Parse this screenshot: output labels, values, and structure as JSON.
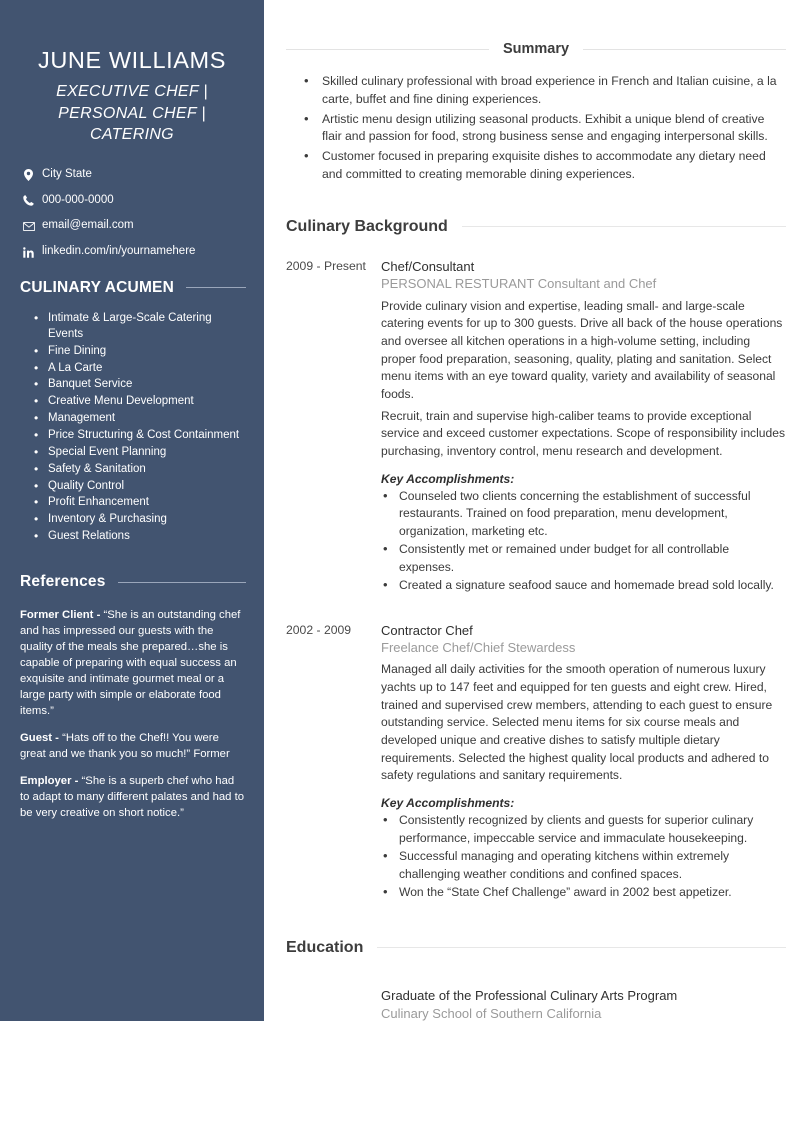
{
  "theme": {
    "sidebar_bg": "#425470",
    "page_bg": "#ffffff",
    "heading_color": "#3d3d3d",
    "muted_color": "#9a9a9a",
    "rule_color": "#e3e3e3"
  },
  "sidebar": {
    "name": "JUNE WILLIAMS",
    "headline": "EXECUTIVE CHEF | PERSONAL CHEF | CATERING",
    "contact": [
      {
        "icon": "location-pin-icon",
        "text": "City State"
      },
      {
        "icon": "phone-icon",
        "text": "000-000-0000"
      },
      {
        "icon": "envelope-icon",
        "text": "email@email.com"
      },
      {
        "icon": "linkedin-icon",
        "text": "linkedin.com/in/yournamehere"
      }
    ],
    "skills_heading": "CULINARY ACUMEN",
    "skills": [
      "Intimate & Large-Scale Catering Events",
      "Fine Dining",
      "A La Carte",
      "Banquet Service",
      "Creative Menu Development",
      "Management",
      "Price Structuring & Cost Containment",
      "Special Event Planning",
      "Safety & Sanitation",
      "Quality Control",
      "Profit Enhancement",
      "Inventory & Purchasing",
      "Guest Relations"
    ],
    "references_heading": "References",
    "references": [
      {
        "who": "Former Client - ",
        "quote": "“She is an outstanding chef and has impressed our guests with the quality of the meals she prepared…she is capable of preparing with equal success an exquisite and intimate gourmet meal or a large party with simple or elaborate food items.”"
      },
      {
        "who": "Guest - ",
        "quote": "“Hats off to the Chef!! You were great and we thank you so much!” Former"
      },
      {
        "who": "Employer - ",
        "quote": "“She is a superb chef who had to adapt to many different palates and had to be very creative on short notice.”"
      }
    ]
  },
  "main": {
    "summary_heading": "Summary",
    "summary_bullets": [
      "Skilled culinary professional with broad experience in French and Italian cuisine, a la carte, buffet and fine dining experiences.",
      "Artistic menu design utilizing seasonal products. Exhibit a unique blend of creative flair and passion for food, strong business sense and engaging interpersonal skills.",
      "Customer focused in preparing exquisite dishes to accommodate any dietary need and committed to creating memorable dining experiences."
    ],
    "experience_heading": "Culinary Background",
    "jobs": [
      {
        "dates": "2009 - Present",
        "title": "Chef/Consultant",
        "company": "PERSONAL RESTURANT Consultant and Chef",
        "paragraphs": [
          "Provide culinary vision and expertise, leading small- and large-scale catering events for up to 300 guests. Drive all back of the house operations and oversee all kitchen operations in a high-volume setting, including proper food preparation, seasoning, quality, plating and sanitation. Select menu items with an eye toward quality, variety and availability of seasonal foods.",
          "Recruit, train and supervise high-caliber teams to provide exceptional service and exceed customer expectations. Scope of responsibility includes purchasing, inventory control, menu research and development."
        ],
        "accomplishments_label": "Key Accomplishments:",
        "accomplishments": [
          "Counseled two clients concerning the establishment of successful restaurants. Trained on food preparation, menu development, organization, marketing etc.",
          "Consistently met or remained under budget for all controllable expenses.",
          "Created a signature seafood sauce and homemade bread sold locally."
        ]
      },
      {
        "dates": "2002 - 2009",
        "title": "Contractor Chef",
        "company": "Freelance Chef/Chief Stewardess",
        "paragraphs": [
          "Managed all daily activities for the smooth operation of numerous luxury yachts up to 147 feet and equipped for ten guests and eight crew. Hired, trained and supervised crew members, attending to each guest to ensure outstanding service. Selected menu items for six course meals and developed unique and creative dishes to satisfy multiple dietary requirements. Selected the highest quality local products and adhered to safety regulations and sanitary requirements."
        ],
        "accomplishments_label": "Key Accomplishments:",
        "accomplishments": [
          "Consistently recognized by clients and guests for superior culinary performance, impeccable service and immaculate housekeeping.",
          "Successful managing and operating kitchens within extremely challenging weather conditions and confined spaces.",
          "Won the “State Chef Challenge” award in 2002 best appetizer."
        ]
      }
    ],
    "education_heading": "Education",
    "education": {
      "degree": "Graduate of the Professional Culinary Arts Program",
      "school": "Culinary School of Southern California"
    }
  }
}
